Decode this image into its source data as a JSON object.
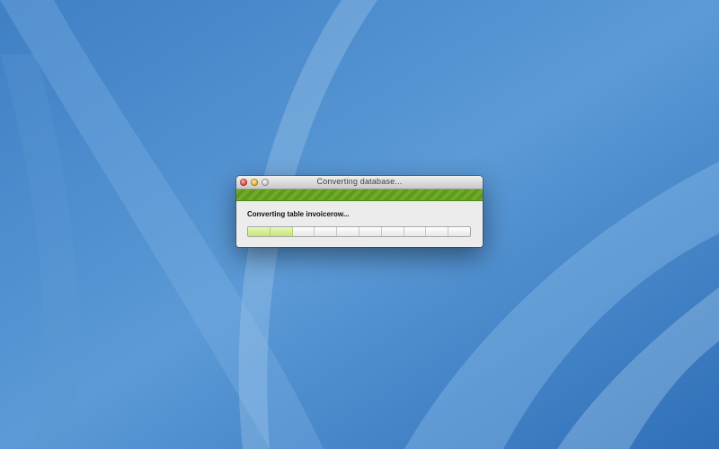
{
  "window": {
    "title": "Converting database...",
    "status_text": "Converting table invoicerow..."
  },
  "progress": {
    "segments_total": 10,
    "segments_filled": 2,
    "fraction": 0.2,
    "fill_color": "#c7e67a"
  },
  "icons": {
    "close": "close-button",
    "minimize": "minimize-button",
    "zoom": "zoom-button"
  },
  "colors": {
    "desktop": "#4e8fd0",
    "stripe": "#6fab26"
  }
}
